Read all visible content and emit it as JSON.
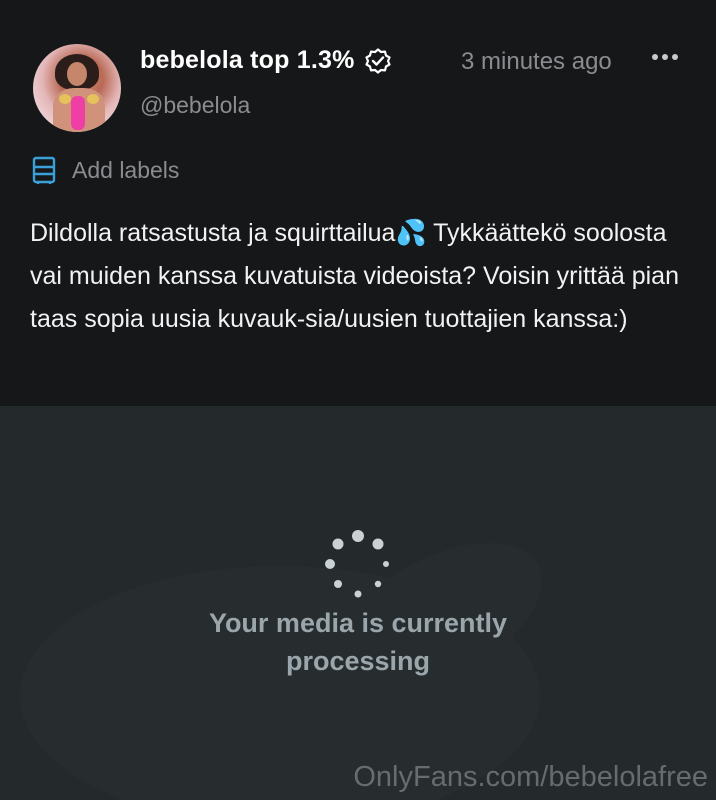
{
  "post": {
    "display_name": "bebelola top 1.3%",
    "handle": "@bebelola",
    "timestamp": "3 minutes ago",
    "labels_link": "Add labels",
    "text": "Dildolla ratsastusta ja squirttailua💦 Tykkäättekö soolosta vai muiden kanssa kuvatuista videoista? Voisin yrittää pian taas sopia uusia kuvauk-sia/uusien tuottajien kanssa:)",
    "icons": {
      "verified": "verified-badge-icon",
      "more": "more-options-icon",
      "labels": "label-tag-icon"
    }
  },
  "media": {
    "status": "Your media is currently processing",
    "watermark": "OnlyFans.com/bebelolafree"
  },
  "colors": {
    "background": "#161719",
    "media_background": "#24292b",
    "accent_blue": "#3aa0d8",
    "muted_text": "#8a8c90"
  }
}
